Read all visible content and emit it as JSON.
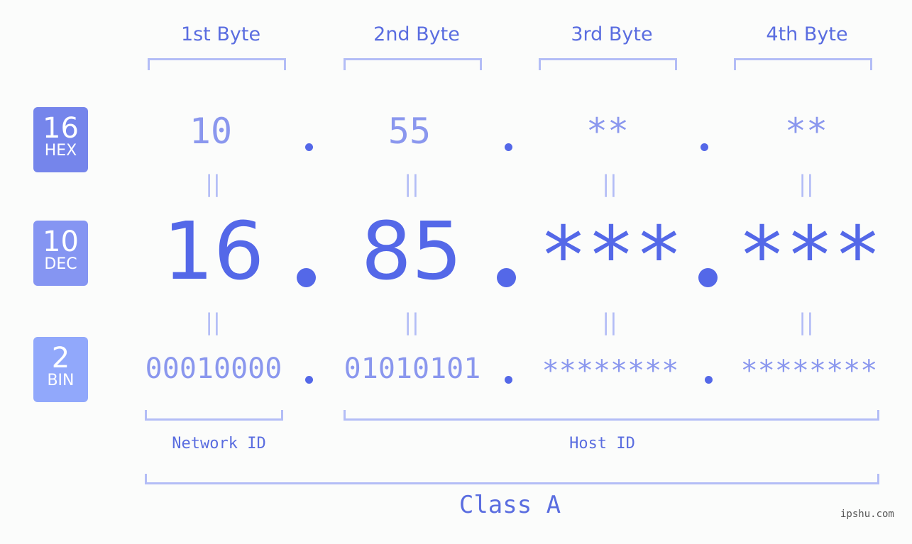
{
  "bytes": [
    {
      "header": "1st Byte",
      "hex": "10",
      "dec": "16",
      "bin": "00010000"
    },
    {
      "header": "2nd Byte",
      "hex": "55",
      "dec": "85",
      "bin": "01010101"
    },
    {
      "header": "3rd Byte",
      "hex": "**",
      "dec": "***",
      "bin": "********"
    },
    {
      "header": "4th Byte",
      "hex": "**",
      "dec": "***",
      "bin": "********"
    }
  ],
  "badges": {
    "hex": {
      "num": "16",
      "label": "HEX",
      "color": "#7585eb"
    },
    "dec": {
      "num": "10",
      "label": "DEC",
      "color": "#8595f2"
    },
    "bin": {
      "num": "2",
      "label": "BIN",
      "color": "#91a8fb"
    }
  },
  "separator": ".",
  "equals": "||",
  "network_label": "Network ID",
  "host_label": "Host ID",
  "class_label": "Class A",
  "watermark": "ipshu.com"
}
